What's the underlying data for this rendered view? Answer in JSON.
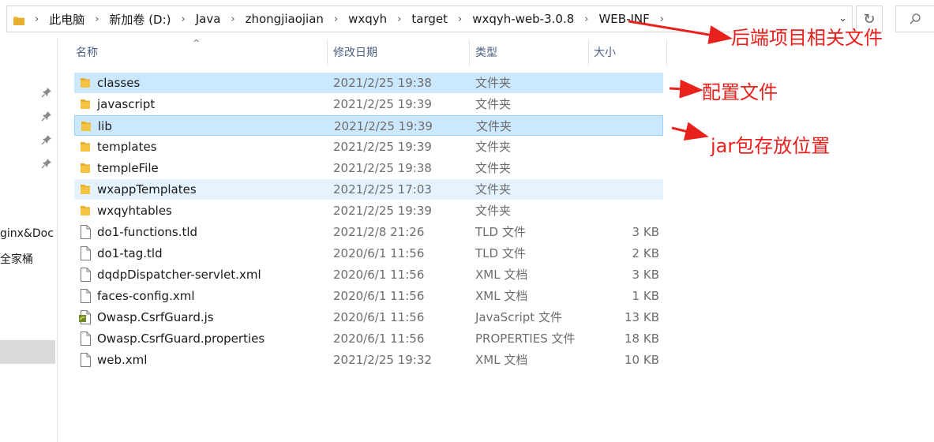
{
  "address_bar": {
    "crumbs": [
      "此电脑",
      "新加卷 (D:)",
      "Java",
      "zhongjiaojian",
      "wxqyh",
      "target",
      "wxqyh-web-3.0.8",
      "WEB-INF"
    ]
  },
  "nav": {
    "items": [
      "ginx&Doc",
      "全家桶"
    ]
  },
  "columns": {
    "name": "名称",
    "date": "修改日期",
    "type": "类型",
    "size": "大小"
  },
  "files": [
    {
      "name": "classes",
      "date": "2021/2/25 19:38",
      "type": "文件夹",
      "size": "",
      "icon": "folder-icon",
      "state": "selected"
    },
    {
      "name": "javascript",
      "date": "2021/2/25 19:39",
      "type": "文件夹",
      "size": "",
      "icon": "folder-icon",
      "state": ""
    },
    {
      "name": "lib",
      "date": "2021/2/25 19:39",
      "type": "文件夹",
      "size": "",
      "icon": "folder-icon",
      "state": "selected-focus"
    },
    {
      "name": "templates",
      "date": "2021/2/25 19:39",
      "type": "文件夹",
      "size": "",
      "icon": "folder-icon",
      "state": ""
    },
    {
      "name": "templeFile",
      "date": "2021/2/25 19:38",
      "type": "文件夹",
      "size": "",
      "icon": "folder-icon",
      "state": ""
    },
    {
      "name": "wxappTemplates",
      "date": "2021/2/25 17:03",
      "type": "文件夹",
      "size": "",
      "icon": "folder-icon",
      "state": "hover"
    },
    {
      "name": "wxqyhtables",
      "date": "2021/2/25 19:39",
      "type": "文件夹",
      "size": "",
      "icon": "folder-icon",
      "state": ""
    },
    {
      "name": "do1-functions.tld",
      "date": "2021/2/8 21:26",
      "type": "TLD 文件",
      "size": "3 KB",
      "icon": "file-icon",
      "state": ""
    },
    {
      "name": "do1-tag.tld",
      "date": "2020/6/1 11:56",
      "type": "TLD 文件",
      "size": "2 KB",
      "icon": "file-icon",
      "state": ""
    },
    {
      "name": "dqdpDispatcher-servlet.xml",
      "date": "2020/6/1 11:56",
      "type": "XML 文档",
      "size": "3 KB",
      "icon": "file-icon",
      "state": ""
    },
    {
      "name": "faces-config.xml",
      "date": "2020/6/1 11:56",
      "type": "XML 文档",
      "size": "1 KB",
      "icon": "file-icon",
      "state": ""
    },
    {
      "name": "Owasp.CsrfGuard.js",
      "date": "2020/6/1 11:56",
      "type": "JavaScript 文件",
      "size": "13 KB",
      "icon": "script-file-icon",
      "state": ""
    },
    {
      "name": "Owasp.CsrfGuard.properties",
      "date": "2020/6/1 11:56",
      "type": "PROPERTIES 文件",
      "size": "18 KB",
      "icon": "file-icon",
      "state": ""
    },
    {
      "name": "web.xml",
      "date": "2021/2/25 19:32",
      "type": "XML 文档",
      "size": "10 KB",
      "icon": "file-icon",
      "state": ""
    }
  ],
  "annotations": {
    "backend": "后端项目相关文件",
    "config": "配置文件",
    "jar": "jar包存放位置"
  },
  "colors": {
    "selection": "#cce8ff",
    "selection_border": "#99d1ff",
    "hover": "#e5f3ff",
    "folder": "#f5c342",
    "annotation": "#e8211d"
  }
}
